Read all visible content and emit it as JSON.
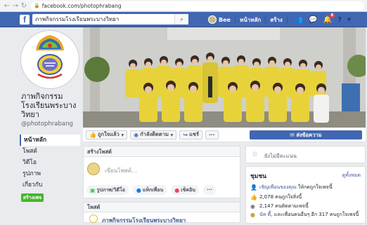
{
  "browser": {
    "url": "facebook.com/photophrabang",
    "back": "←",
    "forward": "→",
    "reload": "↻"
  },
  "topbar": {
    "search_value": "ภาพกิจกรรมโรงเรียนพระบางวิทยา",
    "user_name": "Bee",
    "home_label": "หน้าหลัก",
    "create_label": "สร้าง",
    "notification_count": "8"
  },
  "sidebar": {
    "page_name": "ภาพกิจกรรม โรงเรียนพระบาง วิทยา",
    "page_handle": "@photophrabang",
    "nav": [
      {
        "label": "หน้าหลัก"
      },
      {
        "label": "โพสต์"
      },
      {
        "label": "วิดีโอ"
      },
      {
        "label": "รูปภาพ"
      },
      {
        "label": "เกี่ยวกับ"
      },
      {
        "label": "ชุมชน"
      }
    ],
    "create_page_label": "สร้างเพจ"
  },
  "actions": {
    "like_label": "ถูกใจแล้ว",
    "follow_label": "กำลังติดตาม",
    "share_label": "แชร์",
    "more_label": "···",
    "message_label": "ส่งข้อความ"
  },
  "create_post": {
    "header": "สร้างโพสต์",
    "placeholder": "เขียนโพสต์...",
    "photo_label": "รูปภาพ/วิดีโอ",
    "tag_label": "แท็กเพื่อน",
    "checkin_label": "เช็คอิน",
    "more_label": "···"
  },
  "posts": {
    "header": "โพสต์",
    "author": "ภาพกิจกรรมโรงเรียนพระบางวิทยา"
  },
  "right": {
    "reply_text": "ยังไม่มีคะแนน",
    "community_header": "ชุมชน",
    "see_all": "ดูทั้งหมด",
    "invite_text": "เชิญเพื่อนของคุณ",
    "invite_suffix": " ให้กดถูกใจเพจนี้",
    "likes_text": "2,078 คนถูกใจสิ่งนี้",
    "follows_text": "2,147 คนติดตามเพจนี้",
    "friends_prefix": "นัท ตี้",
    "friends_text": ", และเพื่อนคนอื่นๆ อีก 317 คนถูกใจเพจนี้"
  },
  "colors": {
    "fb_blue": "#4267b2",
    "green": "#42b72a",
    "shirt_yellow": "#e8d23a"
  }
}
